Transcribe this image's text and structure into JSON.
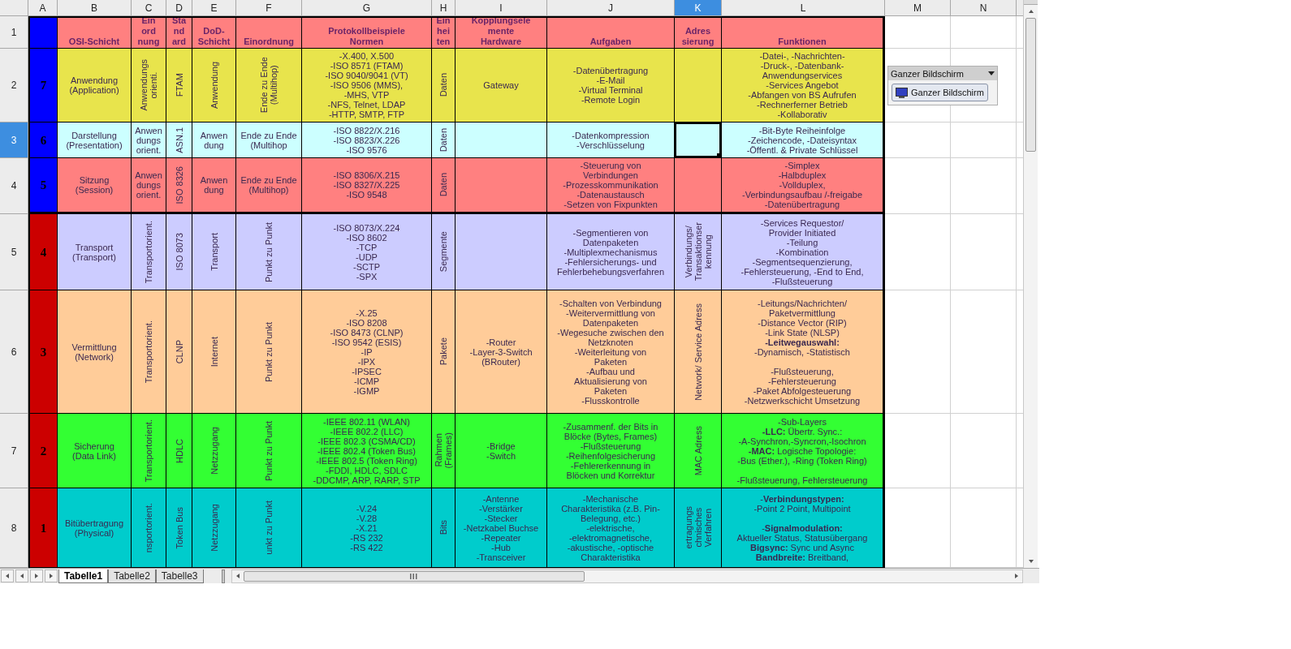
{
  "column_headers": [
    {
      "label": "A",
      "selected": false
    },
    {
      "label": "B",
      "selected": false
    },
    {
      "label": "C",
      "selected": false
    },
    {
      "label": "D",
      "selected": false
    },
    {
      "label": "E",
      "selected": false
    },
    {
      "label": "F",
      "selected": false
    },
    {
      "label": "G",
      "selected": false
    },
    {
      "label": "H",
      "selected": false
    },
    {
      "label": "I",
      "selected": false
    },
    {
      "label": "J",
      "selected": false
    },
    {
      "label": "K",
      "selected": true
    },
    {
      "label": "L",
      "selected": false
    },
    {
      "label": "M",
      "selected": false
    },
    {
      "label": "N",
      "selected": false
    }
  ],
  "rows": [
    {
      "header": {
        "label": "1",
        "selected": false
      },
      "color": "#ff8080",
      "layer": {
        "color": "#0000ff"
      },
      "cells": [
        {
          "kind": "heading",
          "text": "OSI-Schicht"
        },
        {
          "kind": "heading",
          "text": "Ein\nord\nnung"
        },
        {
          "kind": "heading",
          "text": "Sta\nnd\nard"
        },
        {
          "kind": "heading",
          "text": "DoD-\nSchicht"
        },
        {
          "kind": "heading",
          "text": "Einordnung"
        },
        {
          "kind": "heading",
          "text": "Protokollbeispiele\nNormen"
        },
        {
          "kind": "heading",
          "text": "Ein\nhei\nten"
        },
        {
          "kind": "heading",
          "text": "Kopplungsele\nmente\nHardware"
        },
        {
          "kind": "heading",
          "text": "Aufgaben"
        },
        {
          "kind": "heading",
          "text": "Adres\nsierung"
        },
        {
          "kind": "heading",
          "text": "Funktionen"
        }
      ]
    },
    {
      "header": {
        "label": "2",
        "selected": false
      },
      "color": "#e8e44c",
      "layer": {
        "text": "7",
        "color": "#0000ff"
      },
      "cells": [
        {
          "kind": "text",
          "text": "Anwendung\n(Application)"
        },
        {
          "kind": "vertical",
          "text": "Anwendungs\norienti."
        },
        {
          "kind": "vertical",
          "text": "FTAM"
        },
        {
          "kind": "vertical",
          "text": "Anwendung"
        },
        {
          "kind": "vertical",
          "text": "Ende zu Ende\n(Multihop)"
        },
        {
          "kind": "text",
          "text": "-X.400, X.500\n-ISO 8571 (FTAM)\n-ISO 9040/9041 (VT)\n-ISO 9506 (MMS),\n-MHS, VTP\n-NFS, Telnet, LDAP\n-HTTP, SMTP, FTP"
        },
        {
          "kind": "vertical",
          "text": "Daten"
        },
        {
          "kind": "text",
          "text": "Gateway"
        },
        {
          "kind": "text",
          "text": "-Datenübertragung\n-E-Mail\n-Virtual Terminal\n-Remote Login"
        },
        {
          "kind": "empty"
        },
        {
          "kind": "text",
          "text": "-Datei-, -Nachrichten-\n-Druck-, -Datenbank-\nAnwendungservices\n-Services Angebot\n-Abfangen von BS Aufrufen\n-Rechnerferner Betrieb\n-Kollaborativ"
        }
      ]
    },
    {
      "header": {
        "label": "3",
        "selected": true
      },
      "color": "#ccffff",
      "layer": {
        "text": "6",
        "color": "#0000ff"
      },
      "cells": [
        {
          "kind": "text",
          "text": "Darstellung\n(Presentation)"
        },
        {
          "kind": "text",
          "text": "Anwen\ndungs\norient."
        },
        {
          "kind": "vertical",
          "text": "ASN.1"
        },
        {
          "kind": "text",
          "text": "Anwen\ndung"
        },
        {
          "kind": "text",
          "text": "Ende zu Ende\n(Multihop"
        },
        {
          "kind": "text",
          "text": "-ISO 8822/X.216\n-ISO 8823/X.226\n-ISO 9576"
        },
        {
          "kind": "vertical",
          "text": "Daten"
        },
        {
          "kind": "empty"
        },
        {
          "kind": "text",
          "text": "-Datenkompression\n-Verschlüsselung"
        },
        {
          "kind": "empty"
        },
        {
          "kind": "text",
          "text": "-Bit-Byte Reiheinfolge\n-Zeichencode, -Dateisyntax\n-Öffentl. & Private Schlüssel"
        }
      ]
    },
    {
      "header": {
        "label": "4",
        "selected": false
      },
      "color": "#ff8080",
      "layer": {
        "text": "5",
        "color": "#0000ff"
      },
      "cells": [
        {
          "kind": "text",
          "text": "Sitzung\n(Session)"
        },
        {
          "kind": "text",
          "text": "Anwen\ndungs\norient."
        },
        {
          "kind": "vertical",
          "text": "ISO 8326"
        },
        {
          "kind": "text",
          "text": "Anwen\ndung"
        },
        {
          "kind": "text",
          "text": "Ende zu Ende\n(Multihop)"
        },
        {
          "kind": "text",
          "text": "-ISO 8306/X.215\n-ISO 8327/X.225\n-ISO 9548"
        },
        {
          "kind": "vertical",
          "text": "Daten"
        },
        {
          "kind": "empty"
        },
        {
          "kind": "text",
          "text": "-Steuerung von\nVerbindungen\n-Prozesskommunikation\n-Datenaustausch\n-Setzen von Fixpunkten"
        },
        {
          "kind": "empty"
        },
        {
          "kind": "text",
          "text": "-Simplex\n-Halbduplex\n-Vollduplex,\n-Verbindungsaufbau /-freigabe\n-Datenübertragung"
        }
      ]
    },
    {
      "header": {
        "label": "5",
        "selected": false
      },
      "color": "#ccccff",
      "layer": {
        "text": "4",
        "color": "#cc0000"
      },
      "cells": [
        {
          "kind": "text",
          "text": "Transport\n(Transport)"
        },
        {
          "kind": "vertical",
          "text": "Transportorient."
        },
        {
          "kind": "vertical",
          "text": "ISO 8073"
        },
        {
          "kind": "vertical",
          "text": "Transport"
        },
        {
          "kind": "vertical",
          "text": "Punkt zu Punkt"
        },
        {
          "kind": "text",
          "text": "-ISO 8073/X.224\n-ISO 8602\n-TCP\n-UDP\n-SCTP\n-SPX"
        },
        {
          "kind": "vertical",
          "text": "Segmente"
        },
        {
          "kind": "empty"
        },
        {
          "kind": "text",
          "text": "-Segmentieren von\nDatenpaketen\n-Multiplexmechanismus\n-Fehlersicherungs- und\nFehlerbehebungsverfahren"
        },
        {
          "kind": "vertical",
          "text": "Verbindungs/\nTransaktionser\nkennung"
        },
        {
          "kind": "text",
          "text": "-Services Requestor/\nProvider Initiated\n-Teilung\n-Kombination\n-Segmentsequenzierung,\n-Fehlersteuerung, -End to End,\n-Flußsteuerung"
        }
      ]
    },
    {
      "header": {
        "label": "6",
        "selected": false
      },
      "color": "#ffcc99",
      "layer": {
        "text": "3",
        "color": "#cc0000"
      },
      "cells": [
        {
          "kind": "text",
          "text": "Vermittlung\n(Network)"
        },
        {
          "kind": "vertical",
          "text": "Transportorient."
        },
        {
          "kind": "vertical",
          "text": "CLNP"
        },
        {
          "kind": "vertical",
          "text": "Internet"
        },
        {
          "kind": "vertical",
          "text": "Punkt zu Punkt"
        },
        {
          "kind": "text",
          "text": "-X.25\n-ISO 8208\n-ISO 8473 (CLNP)\n-ISO 9542 (ESIS)\n-IP\n-IPX\n-IPSEC\n-ICMP\n-IGMP"
        },
        {
          "kind": "vertical",
          "text": "Pakete"
        },
        {
          "kind": "text",
          "text": "-Router\n-Layer-3-Switch\n(BRouter)"
        },
        {
          "kind": "text",
          "text": "-Schalten von Verbindung\n-Weitervermittlung von\nDatenpaketen\n-Wegesuche zwischen den\nNetzknoten\n-Weiterleitung von\nPaketen\n-Aufbau und\nAktualisierung von\nPaketen\n-Flusskontrolle"
        },
        {
          "kind": "vertical",
          "text": "Network/ Service Adress"
        },
        {
          "kind": "text",
          "text": "-Leitungs/Nachrichten/\nPaketvermittlung\n-Distance Vector (RIP)\n-Link State (NLSP)\n**-Leitwegauswahl:**\n-Dynamisch, -Statistisch\n\n-Flußsteuerung,\n-Fehlersteuerung\n-Paket Abfolgesteuerung\n-Netzwerkschicht Umsetzung"
        }
      ]
    },
    {
      "header": {
        "label": "7",
        "selected": false
      },
      "color": "#33ff33",
      "layer": {
        "text": "2",
        "color": "#cc0000"
      },
      "cells": [
        {
          "kind": "text",
          "text": "Sicherung\n(Data Link)"
        },
        {
          "kind": "vertical",
          "text": "Transportorient."
        },
        {
          "kind": "vertical",
          "text": "HDLC"
        },
        {
          "kind": "vertical",
          "text": "Netzzugang"
        },
        {
          "kind": "vertical",
          "text": "Punkt zu Punkt"
        },
        {
          "kind": "text",
          "text": "-IEEE 802.11 (WLAN)\n-IEEE 802.2 (LLC)\n-IEEE 802.3 (CSMA/CD)\n-IEEE 802.4 (Token Bus)\n-IEEE 802.5 (Token Ring)\n-FDDI, HDLC, SDLC\n-DDCMP, ARP, RARP, STP"
        },
        {
          "kind": "vertical",
          "text": "Rahmen\n(Frames)"
        },
        {
          "kind": "text",
          "text": "-Bridge\n-Switch"
        },
        {
          "kind": "text",
          "text": "-Zusammenf. der Bits in\nBlöcke (Bytes, Frames)\n-Flußsteuerung\n-Reihenfolgesicherung\n-Fehlererkennung in\nBlöcken und Korrektur"
        },
        {
          "kind": "vertical",
          "text": "MAC Adress"
        },
        {
          "kind": "text",
          "text": "-Sub-Layers\n**-LLC:** Übertr. Sync.:\n-A-Synchron,-Syncron,-Isochron\n**-MAC:** Logische Topologie:\n-Bus (Ether.), -Ring (Token Ring)\n\n-Flußsteuerung, Fehlersteuerung"
        }
      ]
    },
    {
      "header": {
        "label": "8",
        "selected": false
      },
      "color": "#00cccc",
      "layer": {
        "text": "1",
        "color": "#cc0000"
      },
      "cells": [
        {
          "kind": "text",
          "text": "Bitübertragung\n(Physical)"
        },
        {
          "kind": "vertical",
          "text": "nsportorient."
        },
        {
          "kind": "vertical",
          "text": "Token Bus"
        },
        {
          "kind": "vertical",
          "text": "Netzzugang"
        },
        {
          "kind": "vertical",
          "text": "unkt zu Punkt"
        },
        {
          "kind": "text",
          "text": "-V.24\n-V.28\n-X.21\n-RS 232\n-RS 422"
        },
        {
          "kind": "vertical",
          "text": "Bits"
        },
        {
          "kind": "text",
          "text": "-Antenne\n-Verstärker\n-Stecker\n-Netzkabel Buchse\n-Repeater\n-Hub\n-Transceiver"
        },
        {
          "kind": "text",
          "text": "-Mechanische\nCharakteristika (z.B. Pin-\nBelegung, etc.)\n-elektrische,\n-elektromagnetische,\n-akustische, -optische\nCharakteristika"
        },
        {
          "kind": "vertical",
          "text": "ertragungs\nchnisches\nVerfahren"
        },
        {
          "kind": "text",
          "text": "-**Verbindungstypen:**\n-Point 2 Point, Multipoint\n\n-**Signalmodulation:**\nAktueller Status, Statusübergang\n**Bigsync:** Sync und Async\n**Bandbreite:** Breitband,"
        }
      ]
    }
  ],
  "toolbar": {
    "title": "Ganzer Bildschirm",
    "button": "Ganzer Bildschirm"
  },
  "sheet_tabs": [
    {
      "label": "Tabelle1",
      "selected": true
    },
    {
      "label": "Tabelle2",
      "selected": false
    },
    {
      "label": "Tabelle3",
      "selected": false
    }
  ]
}
